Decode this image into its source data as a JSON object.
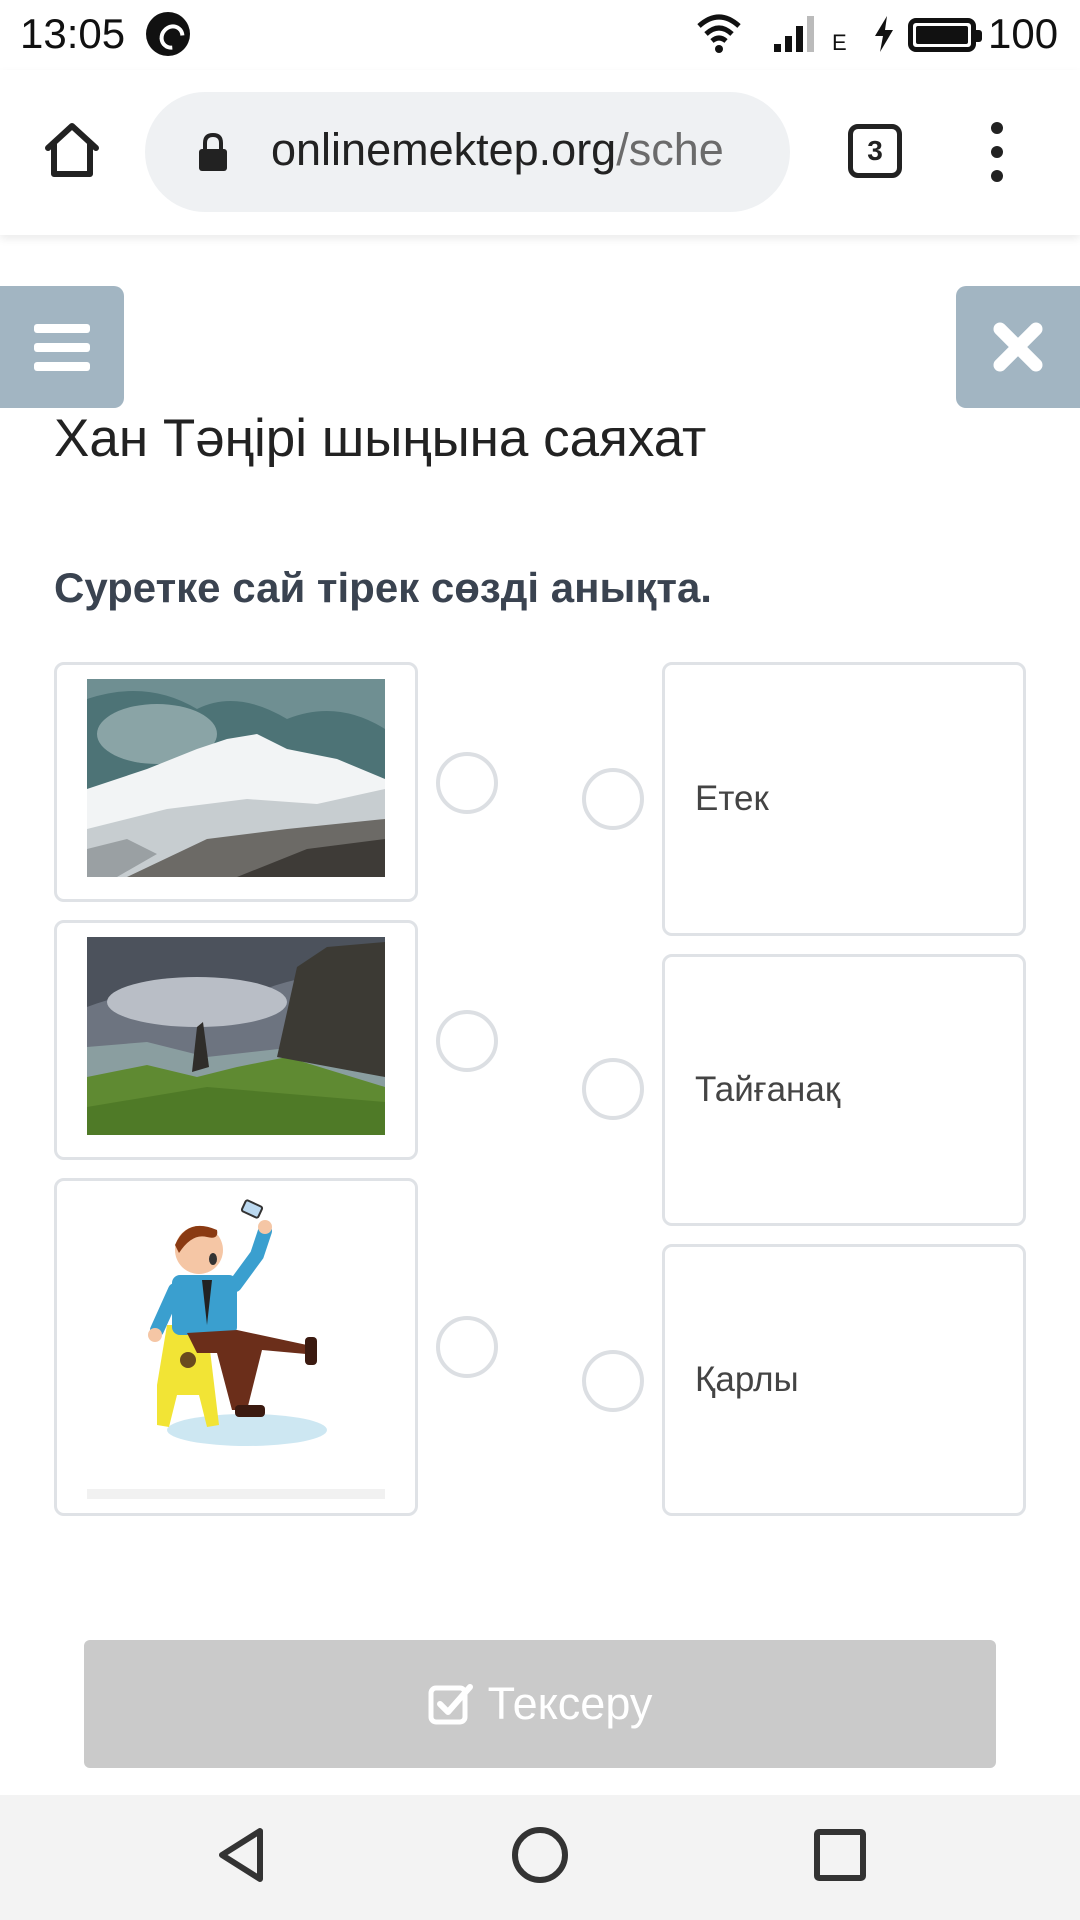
{
  "status_bar": {
    "time": "13:05",
    "network_type": "E",
    "battery": "100",
    "icons": [
      "whatsapp-icon",
      "wifi-icon",
      "signal-icon",
      "charging-icon",
      "battery-icon"
    ]
  },
  "browser": {
    "url_domain": "onlinemektep.org",
    "url_path": "/sche",
    "tab_count": "3",
    "icons": [
      "home-icon",
      "lock-icon",
      "tabs-icon",
      "more-vert-icon"
    ]
  },
  "page": {
    "title": "Хан Тәңірі шыңына саяхат",
    "question": "Суретке сай тірек сөзді анықта.",
    "left_items": [
      {
        "image": "snowy-mountain-photo"
      },
      {
        "image": "green-cliffs-photo"
      },
      {
        "image": "man-slipping-illustration"
      }
    ],
    "right_items": [
      {
        "label": "Етек"
      },
      {
        "label": "Тайғанақ"
      },
      {
        "label": "Қарлы"
      }
    ],
    "check_button": "Тексеру"
  },
  "colors": {
    "side_buttons": "#a2b5c2",
    "check_button_disabled": "#cacaca",
    "card_border": "#dfe2e6"
  }
}
